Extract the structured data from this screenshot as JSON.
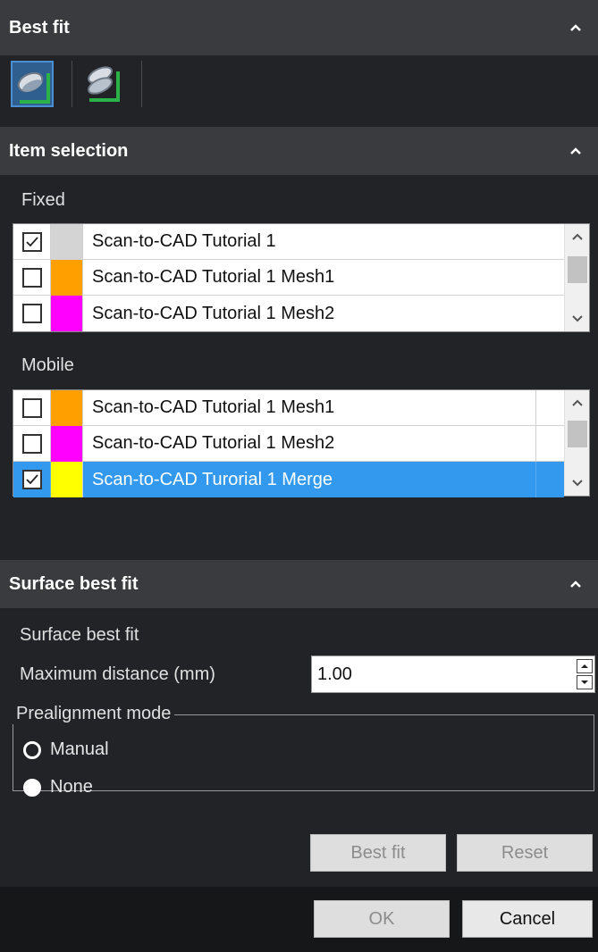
{
  "best_fit_section": {
    "title": "Best fit",
    "tools": [
      {
        "icon": "surface-best-fit-icon",
        "active": true
      },
      {
        "icon": "multi-best-fit-icon",
        "active": false
      }
    ]
  },
  "item_selection_section": {
    "title": "Item selection",
    "fixed_label": "Fixed",
    "fixed_items": [
      {
        "name": "Scan-to-CAD Tutorial 1",
        "checked": true,
        "color": "#d4d4d4"
      },
      {
        "name": "Scan-to-CAD Tutorial 1 Mesh1",
        "checked": false,
        "color": "#ffa000"
      },
      {
        "name": "Scan-to-CAD Tutorial 1 Mesh2",
        "checked": false,
        "color": "#ff00ff"
      }
    ],
    "mobile_label": "Mobile",
    "mobile_items": [
      {
        "name": "Scan-to-CAD Tutorial 1 Mesh1",
        "checked": false,
        "color": "#ffa000",
        "selected": false
      },
      {
        "name": "Scan-to-CAD Tutorial 1 Mesh2",
        "checked": false,
        "color": "#ff00ff",
        "selected": false
      },
      {
        "name": "Scan-to-CAD Turorial 1 Merge",
        "checked": true,
        "color": "#ffff00",
        "selected": true
      }
    ]
  },
  "surface_section": {
    "title": "Surface best fit",
    "subtitle": "Surface best fit",
    "max_distance_label": "Maximum distance (mm)",
    "max_distance_value": "1.00",
    "prealignment_title": "Prealignment mode",
    "options": [
      {
        "label": "Manual",
        "selected": false
      },
      {
        "label": "None",
        "selected": true
      }
    ],
    "best_fit_button": "Best fit",
    "reset_button": "Reset"
  },
  "footer": {
    "ok_button": "OK",
    "cancel_button": "Cancel"
  },
  "colors": {
    "panel_bg": "#222326",
    "header_bg": "#3a3b3e",
    "selection_blue": "#3399ee"
  }
}
